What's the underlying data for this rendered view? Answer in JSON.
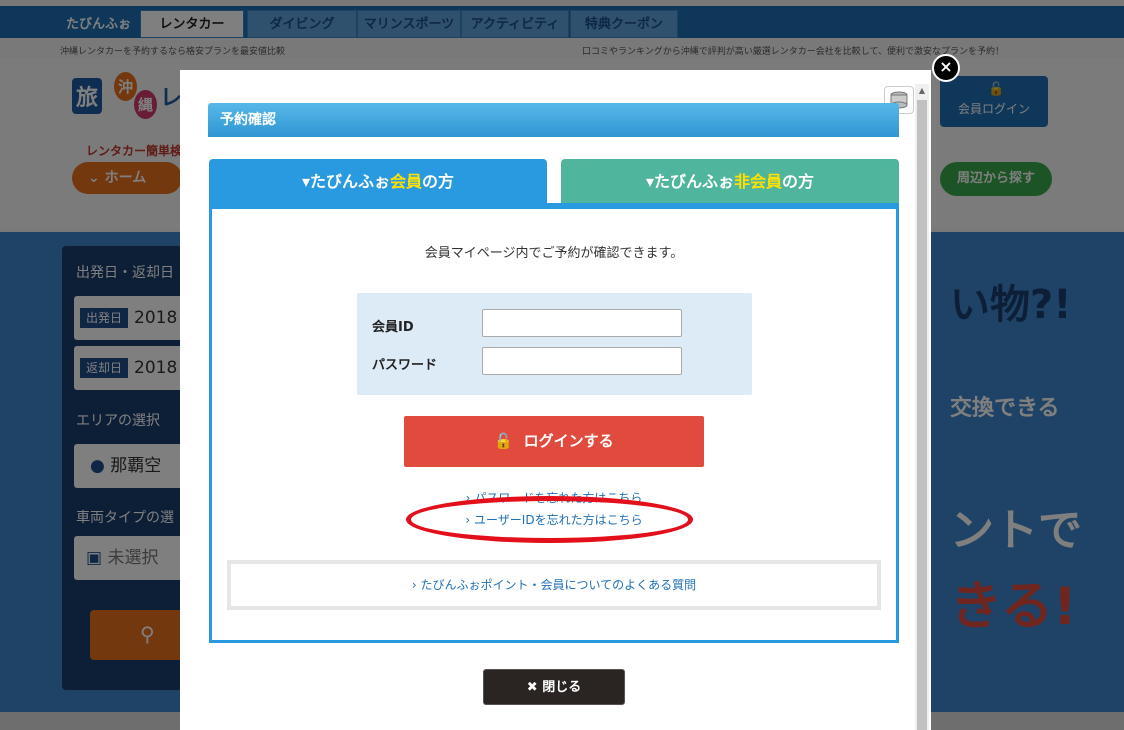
{
  "site": {
    "brand": "たびんふぉ",
    "nav_tabs": [
      "レンタカー",
      "ダイビング",
      "マリンスポーツ",
      "アクティビティ",
      "特典クーポン"
    ],
    "subline_left": "沖縄レンタカーを予約するなら格安プランを最安値比較",
    "subline_right": "口コミやランキングから沖縄で評判が高い厳選レンタカー会社を比較して、便利で激安なプランを予約！",
    "logo_chars": [
      "旅",
      "沖",
      "縄",
      "レ"
    ],
    "crumb_label": "レンタカー簡単検",
    "home_button": "ホーム",
    "member_login": "会員ログイン",
    "area_button": "周辺から探す",
    "hero_texts": [
      "い物?!",
      "交換できる",
      "ントで",
      "きる!"
    ],
    "search": {
      "date_label": "出発日・返却日",
      "depart_tag": "出発日",
      "depart_value": "2018",
      "return_tag": "返却日",
      "return_value": "2018",
      "area_label": "エリアの選択",
      "area_value": "那覇空",
      "vehicle_label": "車両タイプの選",
      "vehicle_value": "未選択"
    }
  },
  "modal": {
    "title": "予約確認",
    "tabs": {
      "member_pre": "たびんふぉ",
      "member_hl": "会員",
      "member_post": "の方",
      "non_pre": "たびんふぉ",
      "non_hl": "非会員",
      "non_post": "の方"
    },
    "intro": "会員マイページ内でご予約が確認できます。",
    "id_label": "会員ID",
    "password_label": "パスワード",
    "login_button": "ログインする",
    "forgot_password": "パスワードを忘れた方はこちら",
    "forgot_userid": "ユーザーIDを忘れた方はこちら",
    "faq": "たびんふぉポイント・会員についてのよくある質問",
    "close_button": "閉じる"
  },
  "colors": {
    "member_tab": "#2a9ae0",
    "nonmember_tab": "#4fb59d",
    "login_button": "#e14b3d",
    "highlight_ellipse": "#e3101b"
  }
}
